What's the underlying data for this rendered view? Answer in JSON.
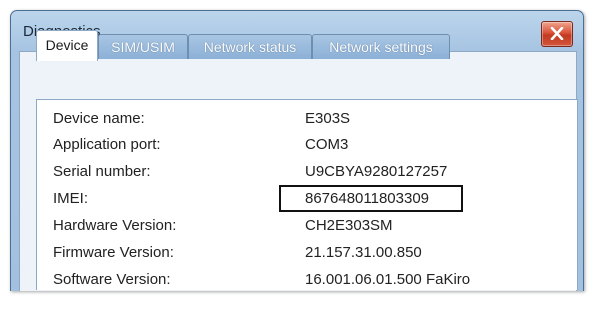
{
  "window": {
    "title": "Diagnostics"
  },
  "tabs": [
    {
      "label": "Device",
      "active": true
    },
    {
      "label": "SIM/USIM",
      "active": false
    },
    {
      "label": "Network status",
      "active": false
    },
    {
      "label": "Network settings",
      "active": false
    }
  ],
  "device": {
    "rows": [
      {
        "label": "Device name:",
        "value": "E303S"
      },
      {
        "label": "Application port:",
        "value": "COM3"
      },
      {
        "label": "Serial number:",
        "value": "U9CBYA9280127257"
      },
      {
        "label": "IMEI:",
        "value": "867648011803309"
      },
      {
        "label": "Hardware Version:",
        "value": "CH2E303SM"
      },
      {
        "label": "Firmware Version:",
        "value": "21.157.31.00.850"
      },
      {
        "label": "Software Version:",
        "value": "16.001.06.01.500 FaKiro"
      }
    ]
  },
  "colors": {
    "frame": "#a6c4e2",
    "close_button": "#c23a21",
    "highlight_border": "#111111"
  },
  "icons": {
    "close": "close-icon"
  }
}
